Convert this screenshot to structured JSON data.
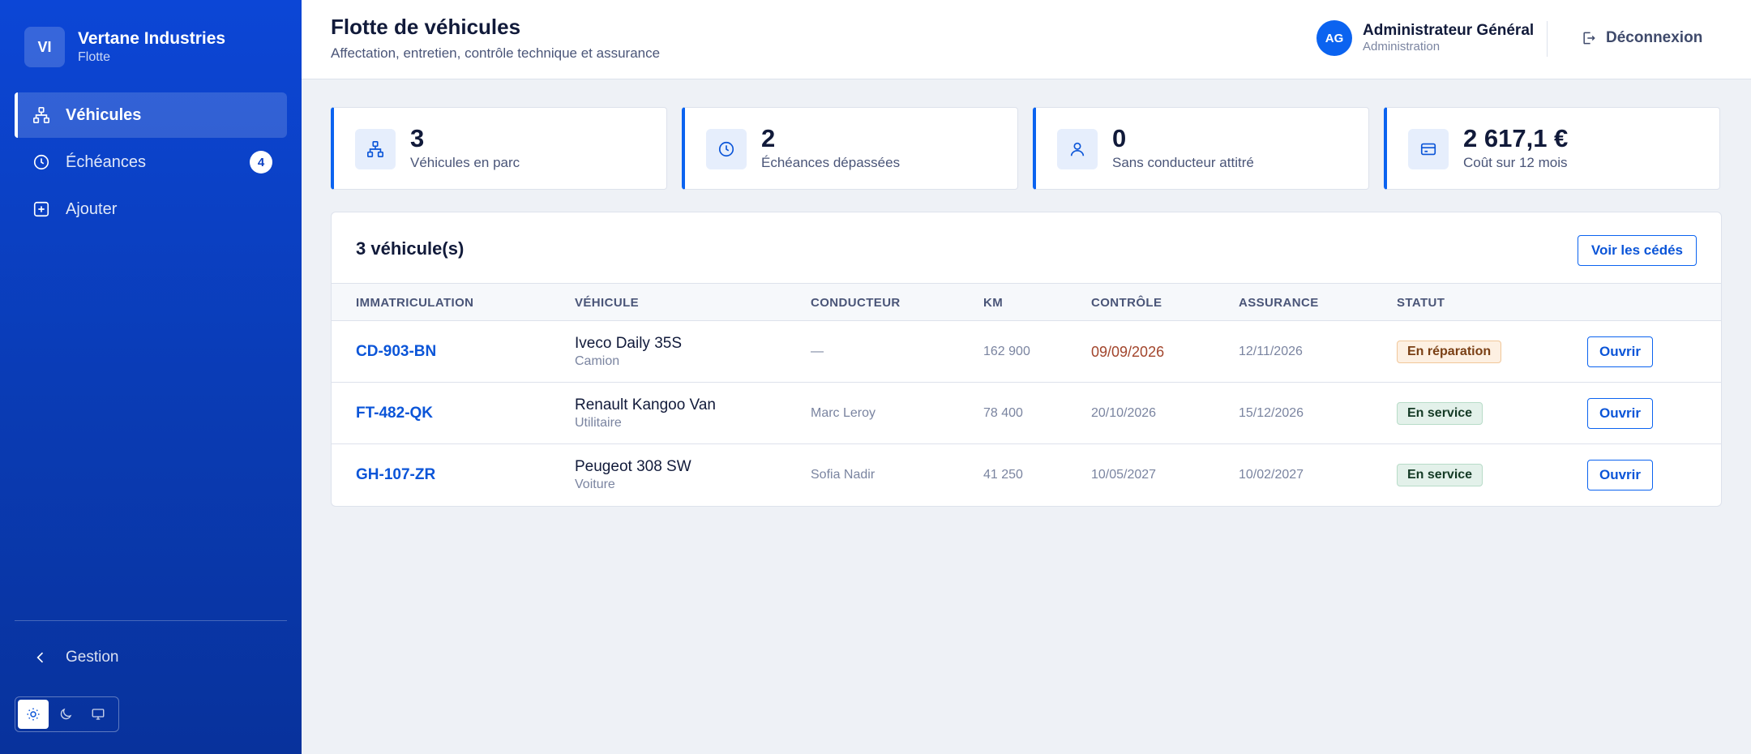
{
  "brand": {
    "initials": "VI",
    "name": "Vertane Industries",
    "subtitle": "Flotte"
  },
  "nav": [
    {
      "label": "Véhicules",
      "icon": "fleet-icon",
      "active": true
    },
    {
      "label": "Échéances",
      "icon": "clock-icon",
      "badge": "4"
    },
    {
      "label": "Ajouter",
      "icon": "plus-square-icon"
    }
  ],
  "sidebar_footer": {
    "collapse_label": "Gestion",
    "theme_options": [
      "light",
      "dark",
      "system"
    ],
    "theme_selected": "light"
  },
  "header": {
    "title": "Flotte de véhicules",
    "subtitle": "Affectation, entretien, contrôle technique et assurance",
    "user": {
      "initials": "AG",
      "name": "Administrateur Général",
      "role": "Administration"
    },
    "logout_label": "Déconnexion"
  },
  "stats": [
    {
      "value": "3",
      "label": "Véhicules en parc",
      "icon": "fleet-icon"
    },
    {
      "value": "2",
      "label": "Échéances dépassées",
      "icon": "clock-icon"
    },
    {
      "value": "0",
      "label": "Sans conducteur attitré",
      "icon": "user-icon"
    },
    {
      "value": "2 617,1 €",
      "label": "Coût sur 12 mois",
      "icon": "card-icon"
    }
  ],
  "table": {
    "title": "3 véhicule(s)",
    "ceded_button": "Voir les cédés",
    "columns": [
      "IMMATRICULATION",
      "VÉHICULE",
      "CONDUCTEUR",
      "KM",
      "CONTRÔLE",
      "ASSURANCE",
      "STATUT"
    ],
    "open_label": "Ouvrir",
    "rows": [
      {
        "plate": "CD-903-BN",
        "model": "Iveco Daily 35S",
        "type": "Camion",
        "driver": "—",
        "km": "162 900",
        "control": "09/09/2026",
        "control_overdue": true,
        "insurance": "12/11/2026",
        "status": "En réparation",
        "status_kind": "repair"
      },
      {
        "plate": "FT-482-QK",
        "model": "Renault Kangoo Van",
        "type": "Utilitaire",
        "driver": "Marc Leroy",
        "km": "78 400",
        "control": "20/10/2026",
        "control_overdue": false,
        "insurance": "15/12/2026",
        "status": "En service",
        "status_kind": "service"
      },
      {
        "plate": "GH-107-ZR",
        "model": "Peugeot 308 SW",
        "type": "Voiture",
        "driver": "Sofia Nadir",
        "km": "41 250",
        "control": "10/05/2027",
        "control_overdue": false,
        "insurance": "10/02/2027",
        "status": "En service",
        "status_kind": "service"
      }
    ]
  },
  "colors": {
    "accent": "#0b63f0",
    "sidebar": "#0c46d6",
    "overdue": "#a2452c"
  }
}
